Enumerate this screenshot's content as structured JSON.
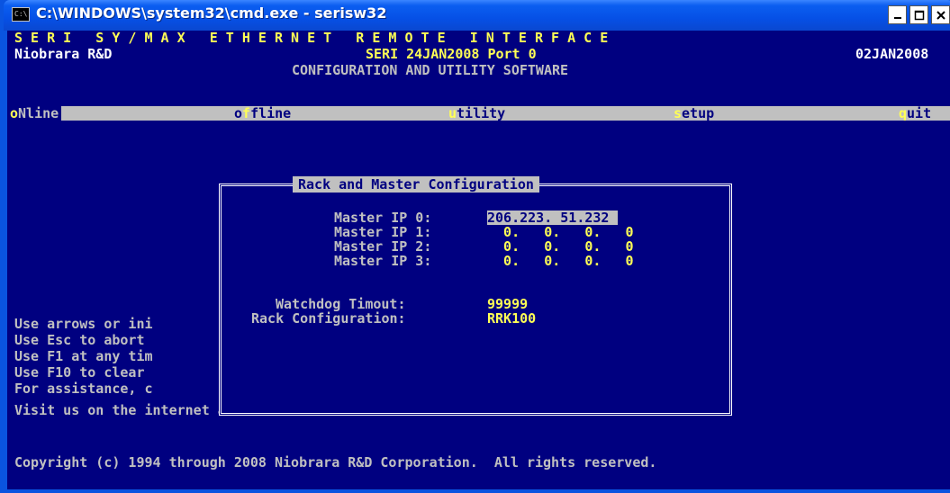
{
  "window": {
    "title": "C:\\WINDOWS\\system32\\cmd.exe - serisw32",
    "icon": "cmd-icon"
  },
  "header": {
    "banner": "S E R I   S Y / M A X   E T H E R N E T   R E M O T E   I N T E R F A C E",
    "company": "Niobrara R&D",
    "version": "SERI 24JAN2008 Port 0",
    "date": "02JAN2008",
    "subtitle": "CONFIGURATION AND UTILITY SOFTWARE"
  },
  "menu": {
    "online": {
      "hot": "o",
      "rest": "Nline"
    },
    "offline": {
      "pre": "o",
      "hot": "f",
      "rest": "fline"
    },
    "utility": {
      "hot": "u",
      "rest": "tility"
    },
    "setup": {
      "hot": "s",
      "rest": "etup"
    },
    "quit": {
      "hot": "q",
      "rest": "uit"
    }
  },
  "dialog": {
    "title": "Rack and Master Configuration",
    "master_ips": [
      {
        "label": "Master IP 0:",
        "value": "206.223. 51.232"
      },
      {
        "label": "Master IP 1:",
        "value": "  0.   0.   0.   0"
      },
      {
        "label": "Master IP 2:",
        "value": "  0.   0.   0.   0"
      },
      {
        "label": "Master IP 3:",
        "value": "  0.   0.   0.   0"
      }
    ],
    "watchdog_label": "Watchdog Timout:",
    "watchdog_value": "99999",
    "rack_label": "Rack Configuration:",
    "rack_value": "RRK100"
  },
  "help": {
    "lines": [
      "Use arrows or ini",
      "Use Esc to abort",
      "Use F1 at any tim",
      "Use F10 to clear",
      "For assistance, c"
    ],
    "visit": "Visit us on the internet at www.niobrara.com"
  },
  "footer": {
    "copyright": "Copyright (c) 1994 through 2008 Niobrara R&D Corporation.  All rights reserved."
  }
}
